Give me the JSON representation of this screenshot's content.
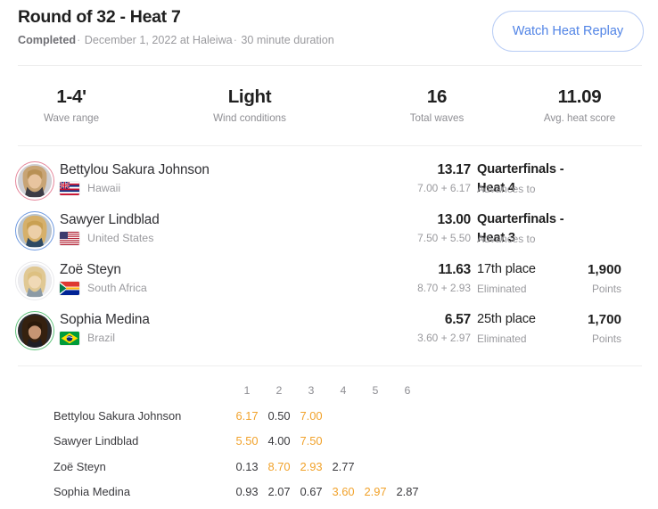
{
  "header": {
    "title": "Round of 32 - Heat 7",
    "status": "Completed",
    "sep1": "·",
    "date_location": "December 1, 2022 at Haleiwa",
    "sep2": "·",
    "duration": "30 minute duration",
    "replay_button": "Watch Heat Replay",
    "accent_blue": "#5184e6"
  },
  "stats": [
    {
      "value": "1-4'",
      "label": "Wave range"
    },
    {
      "value": "Light",
      "label": "Wind conditions"
    },
    {
      "value": "16",
      "label": "Total waves"
    },
    {
      "value": "11.09",
      "label": "Avg. heat score"
    }
  ],
  "athletes": [
    {
      "name": "Bettylou Sakura Johnson",
      "country": "Hawaii",
      "flag": "hawaii-flag-icon",
      "ring_color": "#e5869b",
      "total": "13.17",
      "breakdown": "7.00 + 6.17",
      "outcome": "Quarterfinals - Heat 4",
      "outcome_bold": true,
      "outcome_sub": "Advances to",
      "points": "",
      "points_label": ""
    },
    {
      "name": "Sawyer Lindblad",
      "country": "United States",
      "flag": "usa-flag-icon",
      "ring_color": "#6f9ae0",
      "total": "13.00",
      "breakdown": "7.50 + 5.50",
      "outcome": "Quarterfinals - Heat 3",
      "outcome_bold": true,
      "outcome_sub": "Advances to",
      "points": "",
      "points_label": ""
    },
    {
      "name": "Zoë Steyn",
      "country": "South Africa",
      "flag": "south-africa-flag-icon",
      "ring_color": "#e9e9ec",
      "total": "11.63",
      "breakdown": "8.70 + 2.93",
      "outcome": "17th place",
      "outcome_bold": false,
      "outcome_sub": "Eliminated",
      "points": "1,900",
      "points_label": "Points"
    },
    {
      "name": "Sophia Medina",
      "country": "Brazil",
      "flag": "brazil-flag-icon",
      "ring_color": "#5fc17a",
      "total": "6.57",
      "breakdown": "3.60 + 2.97",
      "outcome": "25th place",
      "outcome_bold": false,
      "outcome_sub": "Eliminated",
      "points": "1,700",
      "points_label": "Points"
    }
  ],
  "wave_table": {
    "columns": [
      "1",
      "2",
      "3",
      "4",
      "5",
      "6"
    ],
    "counted_color": "#f1a22b",
    "rows": [
      {
        "name": "Bettylou Sakura Johnson",
        "scores": [
          "6.17",
          "0.50",
          "7.00",
          "",
          "",
          ""
        ],
        "counted": [
          true,
          false,
          true,
          false,
          false,
          false
        ]
      },
      {
        "name": "Sawyer Lindblad",
        "scores": [
          "5.50",
          "4.00",
          "7.50",
          "",
          "",
          ""
        ],
        "counted": [
          true,
          false,
          true,
          false,
          false,
          false
        ]
      },
      {
        "name": "Zoë Steyn",
        "scores": [
          "0.13",
          "8.70",
          "2.93",
          "2.77",
          "",
          ""
        ],
        "counted": [
          false,
          true,
          true,
          false,
          false,
          false
        ]
      },
      {
        "name": "Sophia Medina",
        "scores": [
          "0.93",
          "2.07",
          "0.67",
          "3.60",
          "2.97",
          "2.87"
        ],
        "counted": [
          false,
          false,
          false,
          true,
          true,
          false
        ]
      }
    ]
  }
}
